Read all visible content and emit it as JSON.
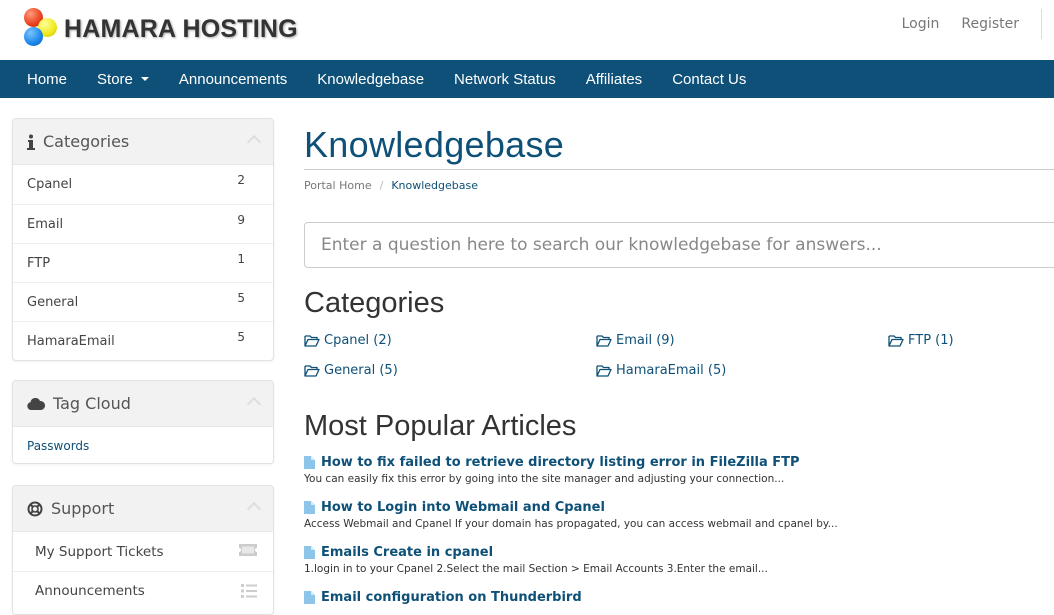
{
  "brand": {
    "name": "HAMARA HOSTING"
  },
  "top_links": {
    "login": "Login",
    "register": "Register"
  },
  "nav": {
    "items": [
      {
        "label": "Home"
      },
      {
        "label": "Store",
        "dropdown": true
      },
      {
        "label": "Announcements"
      },
      {
        "label": "Knowledgebase"
      },
      {
        "label": "Network Status"
      },
      {
        "label": "Affiliates"
      },
      {
        "label": "Contact Us"
      }
    ]
  },
  "sidebar": {
    "categories": {
      "title": "Categories",
      "items": [
        {
          "label": "Cpanel",
          "count": "2"
        },
        {
          "label": "Email",
          "count": "9"
        },
        {
          "label": "FTP",
          "count": "1"
        },
        {
          "label": "General",
          "count": "5"
        },
        {
          "label": "HamaraEmail",
          "count": "5"
        }
      ]
    },
    "tag_cloud": {
      "title": "Tag Cloud",
      "tags": [
        "Passwords"
      ]
    },
    "support": {
      "title": "Support",
      "items": [
        {
          "label": "My Support Tickets",
          "icon": "ticket-icon"
        },
        {
          "label": "Announcements",
          "icon": "list-icon"
        }
      ]
    }
  },
  "main": {
    "title": "Knowledgebase",
    "breadcrumb": {
      "home": "Portal Home",
      "separator": "/",
      "current": "Knowledgebase"
    },
    "search": {
      "placeholder": "Enter a question here to search our knowledgebase for answers...",
      "value": ""
    },
    "categories_heading": "Categories",
    "categories": [
      {
        "label": "Cpanel (2)"
      },
      {
        "label": "Email (9)"
      },
      {
        "label": "FTP (1)"
      },
      {
        "label": "General (5)"
      },
      {
        "label": "HamaraEmail (5)"
      }
    ],
    "popular_heading": "Most Popular Articles",
    "articles": [
      {
        "title": "How to fix failed to retrieve directory listing error in FileZilla FTP",
        "desc": "You can easily fix this error by going into the site manager and adjusting your connection..."
      },
      {
        "title": "How to Login into Webmail and Cpanel",
        "desc": "Access Webmail and Cpanel If your domain has propagated, you can access webmail and cpanel by..."
      },
      {
        "title": "Emails Create in cpanel",
        "desc": "1.login in to your Cpanel  2.Select the mail Section > Email Accounts   3.Enter the email..."
      },
      {
        "title": "Email configuration on Thunderbird",
        "desc": ""
      }
    ]
  },
  "colors": {
    "brand": "#0e5077",
    "panel_header": "#f2f2f2",
    "doc_icon": "#8cc4ea"
  }
}
